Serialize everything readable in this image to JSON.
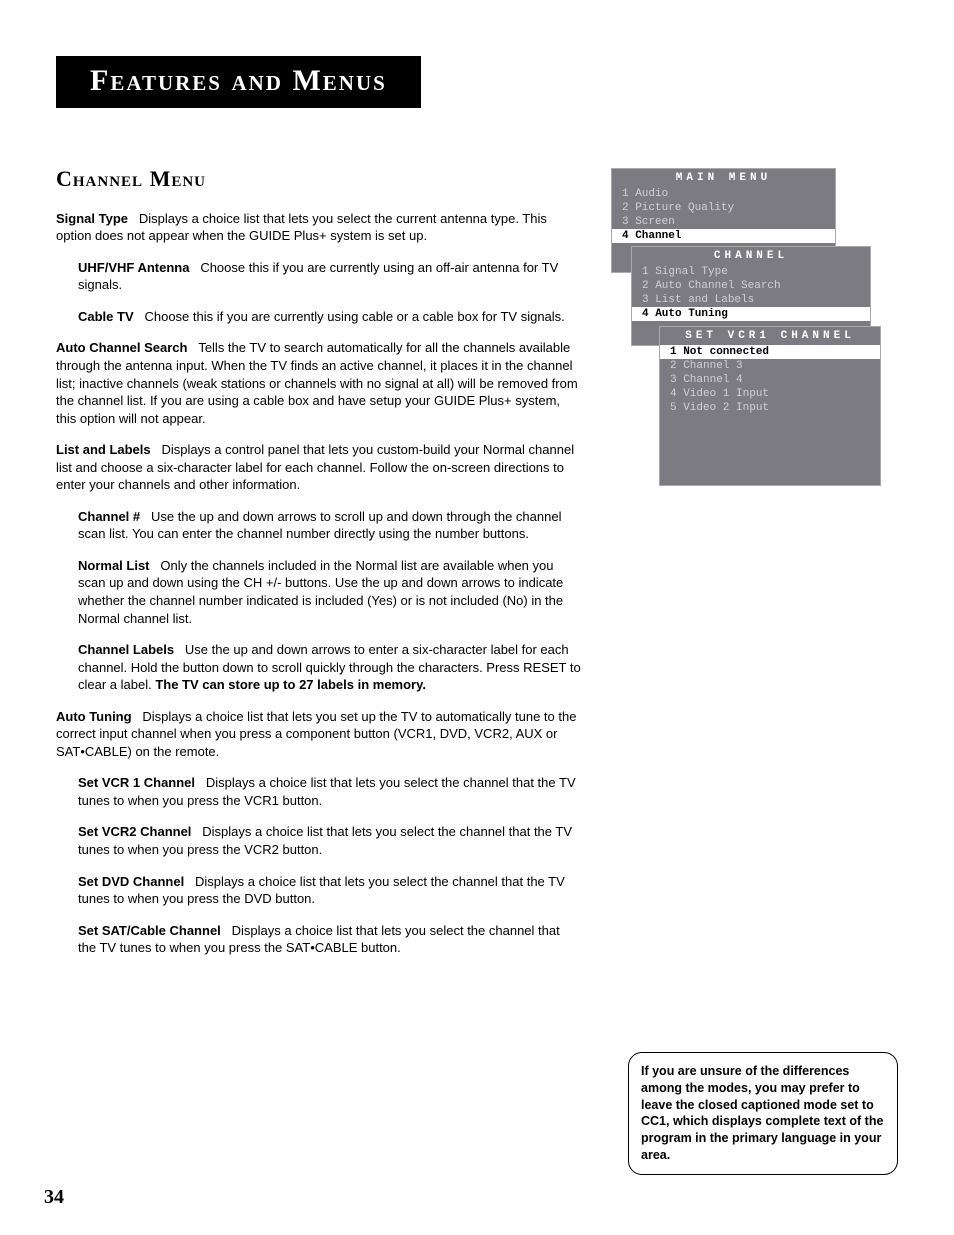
{
  "page_number": "34",
  "header": "Features and Menus",
  "section_title": "Channel Menu",
  "entries": [
    {
      "label": "Signal Type",
      "text": "Displays a choice list that lets you select the current antenna type. This option does not appear when the GUIDE Plus+ system is set up."
    },
    {
      "label": "UHF/VHF Antenna",
      "text": "Choose this if you are currently using an off-air antenna for TV signals.",
      "sub": true
    },
    {
      "label": "Cable TV",
      "text": "Choose this if you are currently using cable or a cable box for TV signals.",
      "sub": true
    },
    {
      "label": "Auto Channel Search",
      "text": "Tells the TV to search automatically for all the channels available through the antenna input. When the TV finds an active channel, it places it in the channel list; inactive channels (weak stations or channels with no signal at all) will be removed from the channel list. If you are using a cable box and have setup your GUIDE Plus+ system, this option will not appear."
    },
    {
      "label": "List and Labels",
      "text": "Displays a control panel that lets you custom-build your Normal channel list and choose a six-character label for each channel. Follow the on-screen directions to enter your channels and other information."
    },
    {
      "label": "Channel #",
      "text": "Use the up and down arrows to scroll up and down through the channel scan list. You can enter the channel number directly using the number buttons.",
      "sub": true
    },
    {
      "label": "Normal List",
      "text": "Only the channels included in the Normal list are available when you scan up and down using the CH +/- buttons. Use the up and down arrows to indicate whether the channel number indicated is included (Yes) or is not included (No) in the Normal channel list.",
      "sub": true
    },
    {
      "label": "Channel Labels",
      "text": "Use the up and down arrows to enter a six-character label for each channel. Hold the button down to scroll quickly through the characters. Press RESET to clear a label. ",
      "bold_tail": "The TV can store up to 27 labels in memory.",
      "sub": true
    },
    {
      "label": "Auto Tuning",
      "text": "Displays a choice list that lets you set up the TV to automatically tune to the correct input channel when you press a component button (VCR1, DVD, VCR2, AUX or SAT•CABLE) on the remote."
    },
    {
      "label": "Set VCR 1 Channel",
      "text": "Displays a choice list that lets you select the channel that the TV tunes to when you press the VCR1 button.",
      "sub": true
    },
    {
      "label": "Set VCR2 Channel",
      "text": "Displays a choice list that lets you select the channel that the TV tunes to when you press the VCR2 button.",
      "sub": true
    },
    {
      "label": "Set DVD Channel",
      "text": "Displays a choice list that lets you select the channel that the TV tunes to when you press the DVD button.",
      "sub": true
    },
    {
      "label": "Set SAT/Cable Channel",
      "text": "Displays a choice list that lets you select the channel that the TV tunes to when you press the SAT•CABLE button.",
      "sub": true
    }
  ],
  "osd": {
    "menu1": {
      "title": "MAIN MENU",
      "rows": [
        {
          "t": "1 Audio"
        },
        {
          "t": "2 Picture Quality"
        },
        {
          "t": "3 Screen"
        },
        {
          "t": "4 Channel",
          "hl": true
        }
      ]
    },
    "menu2": {
      "title": "CHANNEL",
      "rows": [
        {
          "t": "1 Signal Type"
        },
        {
          "t": "2 Auto Channel Search"
        },
        {
          "t": "3 List and Labels"
        },
        {
          "t": "4 Auto Tuning",
          "hl": true
        }
      ]
    },
    "menu3": {
      "title": "SET VCR1 CHANNEL",
      "rows": [
        {
          "t": "1 Not connected",
          "hl": true
        },
        {
          "t": "2 Channel 3"
        },
        {
          "t": "3 Channel 4"
        },
        {
          "t": "4 Video 1 Input"
        },
        {
          "t": "5 Video 2 Input"
        }
      ]
    }
  },
  "note": "If you are unsure of the differences among the modes, you may prefer to leave the closed captioned mode set to CC1, which displays complete text of the program in the primary language in your area."
}
